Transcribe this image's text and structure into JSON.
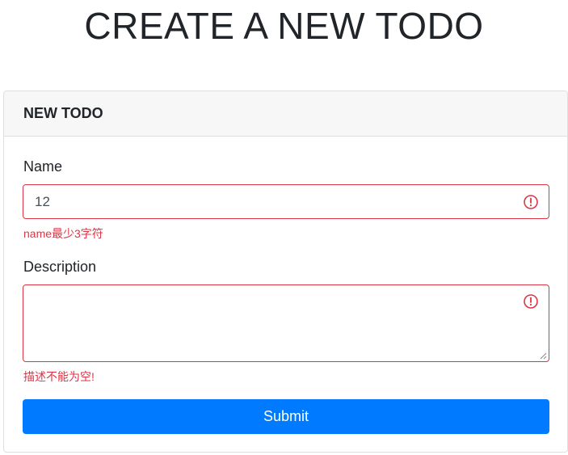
{
  "page": {
    "title": "CREATE A NEW TODO"
  },
  "card": {
    "header": "NEW TODO"
  },
  "form": {
    "name": {
      "label": "Name",
      "value": "12",
      "error": "name最少3字符"
    },
    "description": {
      "label": "Description",
      "value": "",
      "error": "描述不能为空!"
    },
    "submit_label": "Submit"
  },
  "colors": {
    "error": "#dc3545",
    "primary": "#007bff",
    "header_bg": "#f7f7f7"
  },
  "icons": {
    "field_invalid": "exclamation-circle-icon"
  }
}
